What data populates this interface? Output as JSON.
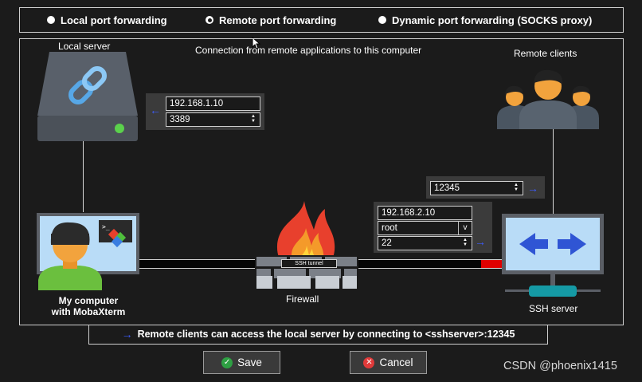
{
  "modes": [
    {
      "label": "Local port forwarding",
      "selected": false
    },
    {
      "label": "Remote port forwarding",
      "selected": true
    },
    {
      "label": "Dynamic port forwarding (SOCKS proxy)",
      "selected": false
    }
  ],
  "diagram": {
    "local_server_label": "Local server",
    "connection_caption": "Connection from remote applications to this computer",
    "remote_clients_label": "Remote clients",
    "my_computer_label_line1": "My computer",
    "my_computer_label_line2": "with MobaXterm",
    "firewall_label": "Firewall",
    "tunnel_label": "SSH tunnel",
    "ssh_server_label": "SSH server"
  },
  "fields": {
    "local_host": "192.168.1.10",
    "local_port": "3389",
    "remote_port": "12345",
    "ssh_host": "192.168.2.10",
    "ssh_user": "root",
    "ssh_port": "22"
  },
  "info_text": "Remote clients can access the local server by connecting to <sshserver>:12345",
  "buttons": {
    "save": "Save",
    "cancel": "Cancel"
  },
  "watermark": "CSDN @phoenix1415",
  "colors": {
    "accent_blue": "#3d5cff",
    "tunnel_red": "#e00000",
    "save_green": "#2ea043",
    "cancel_red": "#e03a3a"
  }
}
